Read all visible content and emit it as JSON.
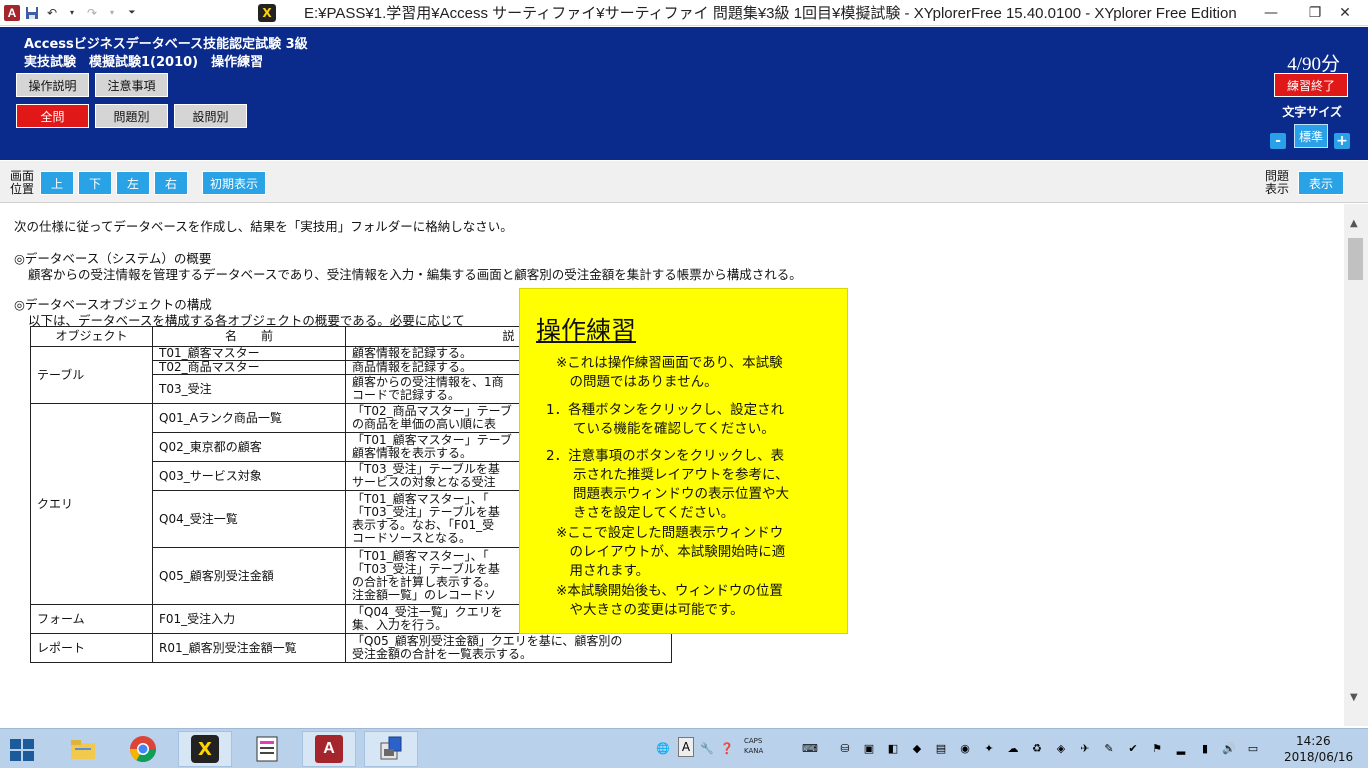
{
  "titlebar": {
    "title": "E:¥PASS¥1.学習用¥Access サーティファイ¥サーティファイ 問題集¥3級 1回目¥模擬試験 - XYplorerFree 15.40.0100 - XYplorer Free Edition",
    "app_logo": "A",
    "app_icon": "X"
  },
  "header": {
    "exam_title": "Accessビジネスデータベース技能認定試験 3級",
    "exam_sub": "実技試験　模擬試験1(2010)　操作練習",
    "buttons": {
      "instructions": "操作説明",
      "notes": "注意事項",
      "all": "全問",
      "by_problem": "問題別",
      "by_question": "設問別",
      "end_practice": "練習終了"
    },
    "timer": "4/90分",
    "font_size_label": "文字サイズ",
    "font_size_value": "標準",
    "font_minus": "-",
    "font_plus": "+"
  },
  "toolbar": {
    "position_label_1": "画面",
    "position_label_2": "位置",
    "up": "上",
    "down": "下",
    "left": "左",
    "right": "右",
    "reset": "初期表示",
    "problem_label_1": "問題",
    "problem_label_2": "表示",
    "show": "表示"
  },
  "content": {
    "intro": "次の仕様に従ってデータベースを作成し、結果を「実技用」フォルダーに格納しなさい。",
    "overview_heading": "◎データベース（システム）の概要",
    "overview_text": "顧客からの受注情報を管理するデータベースであり、受注情報を入力・編集する画面と顧客別の受注金額を集計する帳票から構成される。",
    "objects_heading": "◎データベースオブジェクトの構成",
    "objects_text": "以下は、データベースを構成する各オブジェクトの概要である。必要に応じて",
    "table": {
      "headers": [
        "オブジェクト",
        "名　　前",
        "説"
      ],
      "groups": {
        "table": "テーブル",
        "query": "クエリ",
        "form": "フォーム",
        "report": "レポート"
      },
      "rows": [
        {
          "name": "T01_顧客マスター",
          "desc1": "顧客情報を記録する。",
          "desc2": ""
        },
        {
          "name": "T02_商品マスター",
          "desc1": "商品情報を記録する。",
          "desc2": ""
        },
        {
          "name": "T03_受注",
          "desc1": "顧客からの受注情報を、1商",
          "desc2": "コードで記録する。"
        },
        {
          "name": "Q01_Aランク商品一覧",
          "desc1": "「T02_商品マスター」テーブ",
          "desc2": "の商品を単価の高い順に表"
        },
        {
          "name": "Q02_東京都の顧客",
          "desc1": "「T01_顧客マスター」テーブ",
          "desc2": "顧客情報を表示する。"
        },
        {
          "name": "Q03_サービス対象",
          "desc1": "「T03_受注」テーブルを基",
          "desc2": "サービスの対象となる受注"
        },
        {
          "name": "Q04_受注一覧",
          "desc1": "「T01_顧客マスター」、「",
          "desc2": "「T03_受注」テーブルを基",
          "desc3": "表示する。なお、「F01_受",
          "desc4": "コードソースとなる。"
        },
        {
          "name": "Q05_顧客別受注金額",
          "desc1": "「T01_顧客マスター」、「",
          "desc2": "「T03_受注」テーブルを基",
          "desc3": "の合計を計算し表示する。",
          "desc4": "注金額一覧」のレコードソ"
        },
        {
          "name": "F01_受注入力",
          "desc1": "「Q04_受注一覧」クエリを",
          "desc2": "集、入力を行う。"
        },
        {
          "name": "R01_顧客別受注金額一覧",
          "desc1": "「Q05_顧客別受注金額」クエリを基に、顧客別の",
          "desc2": "受注金額の合計を一覧表示する。"
        }
      ]
    }
  },
  "popup": {
    "title": "操作練習",
    "lines": [
      "※これは操作練習画面であり、本試験",
      "　の問題ではありません。",
      "1．各種ボタンをクリックし、設定され",
      "　　ている機能を確認してください。",
      "2．注意事項のボタンをクリックし、表",
      "　　示された推奨レイアウトを参考に、",
      "　　問題表示ウィンドウの表示位置や大",
      "　　きさを設定してください。",
      "※ここで設定した問題表示ウィンドウ",
      "　のレイアウトが、本試験開始時に適",
      "　用されます。",
      "※本試験開始後も、ウィンドウの位置",
      "　や大きさの変更は可能です。"
    ]
  },
  "taskbar": {
    "time": "14:26",
    "date": "2018/06/16",
    "caps": "CAPS",
    "kana": "KANA",
    "ime": "A"
  },
  "colors": {
    "header_bg": "#0a2a8c",
    "accent_blue": "#2aa2e6",
    "active_red": "#e01818",
    "popup_yellow": "#ffff00",
    "taskbar": "#b9d1ea"
  }
}
